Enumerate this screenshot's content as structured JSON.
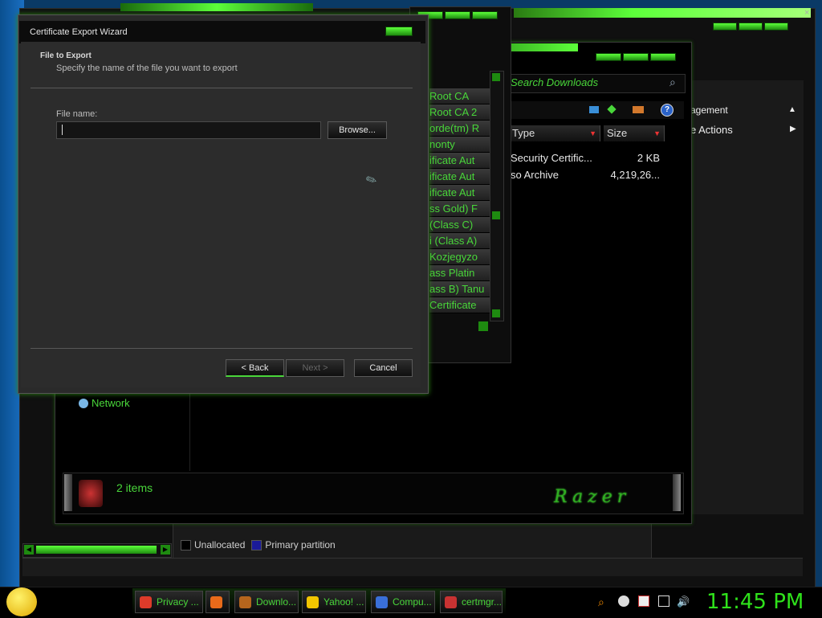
{
  "dialog": {
    "title": "Certificate Export Wizard",
    "heading": "File to Export",
    "subheading": "Specify the name of the file you want to export",
    "file_label": "File name:",
    "file_value": "",
    "browse_label": "Browse...",
    "back_label": "< Back",
    "next_label": "Next >",
    "cancel_label": "Cancel"
  },
  "cert_list": {
    "rows": [
      "Root CA",
      "Root CA 2",
      "orde(tm) R",
      "nonty",
      "ificate Aut",
      "ificate Aut",
      "ificate Aut",
      "ss Gold) F",
      "(Class C)",
      "i (Class A)",
      "Kozjegyzo",
      "ass Platin",
      "ass B) Tanu",
      "Certificate"
    ]
  },
  "downloads": {
    "search_placeholder": "Search Downloads",
    "columns": [
      "Type",
      "Size"
    ],
    "files": [
      {
        "type": "Security Certific...",
        "size": "2 KB"
      },
      {
        "type": "so Archive",
        "size": "4,219,26..."
      }
    ],
    "nav_network": "Network",
    "item_count": "2 items",
    "brand": "Razer"
  },
  "actions_pane": {
    "items": [
      "agement",
      "e Actions"
    ]
  },
  "disk_legend": {
    "items": [
      {
        "label": "Unallocated",
        "color": "#000000"
      },
      {
        "label": "Primary partition",
        "color": "#1a1a99"
      }
    ]
  },
  "taskbar": {
    "tasks": [
      {
        "label": "Privacy ...",
        "icon": "chrome-icon",
        "color": "#dd3b2a"
      },
      {
        "label": "",
        "icon": "firefox-icon",
        "color": "#e86a1a"
      },
      {
        "label": "Downlo...",
        "icon": "folder-icon",
        "color": "#b5651d"
      },
      {
        "label": "Yahoo! ...",
        "icon": "yahoo-messenger-icon",
        "color": "#f2c500"
      },
      {
        "label": "Compu...",
        "icon": "computer-management-icon",
        "color": "#3a6fd8"
      },
      {
        "label": "certmgr...",
        "icon": "certmgr-icon",
        "color": "#c83232"
      }
    ],
    "clock": "11:45 PM"
  }
}
